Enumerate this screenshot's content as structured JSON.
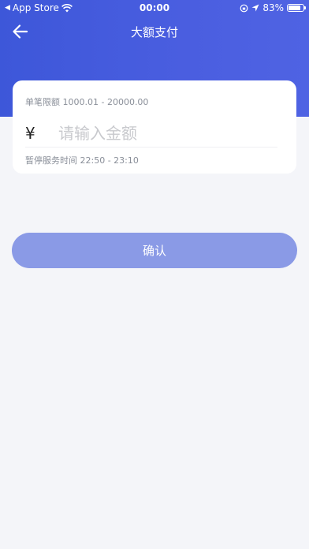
{
  "status_bar": {
    "back_app": "App Store",
    "time": "00:00",
    "battery": "83%",
    "battery_level": 0.83
  },
  "nav": {
    "title": "大额支付"
  },
  "card": {
    "limit_text": "单笔限额 1000.01 - 20000.00",
    "currency_symbol": "¥",
    "amount_value": "",
    "amount_placeholder": "请输入金额",
    "pause_text": "暂停服务时间 22:50 - 23:10"
  },
  "confirm": {
    "label": "确认"
  },
  "colors": {
    "header": "#4257dd",
    "confirm_button": "#8a9ae6",
    "background": "#f4f5f9"
  }
}
